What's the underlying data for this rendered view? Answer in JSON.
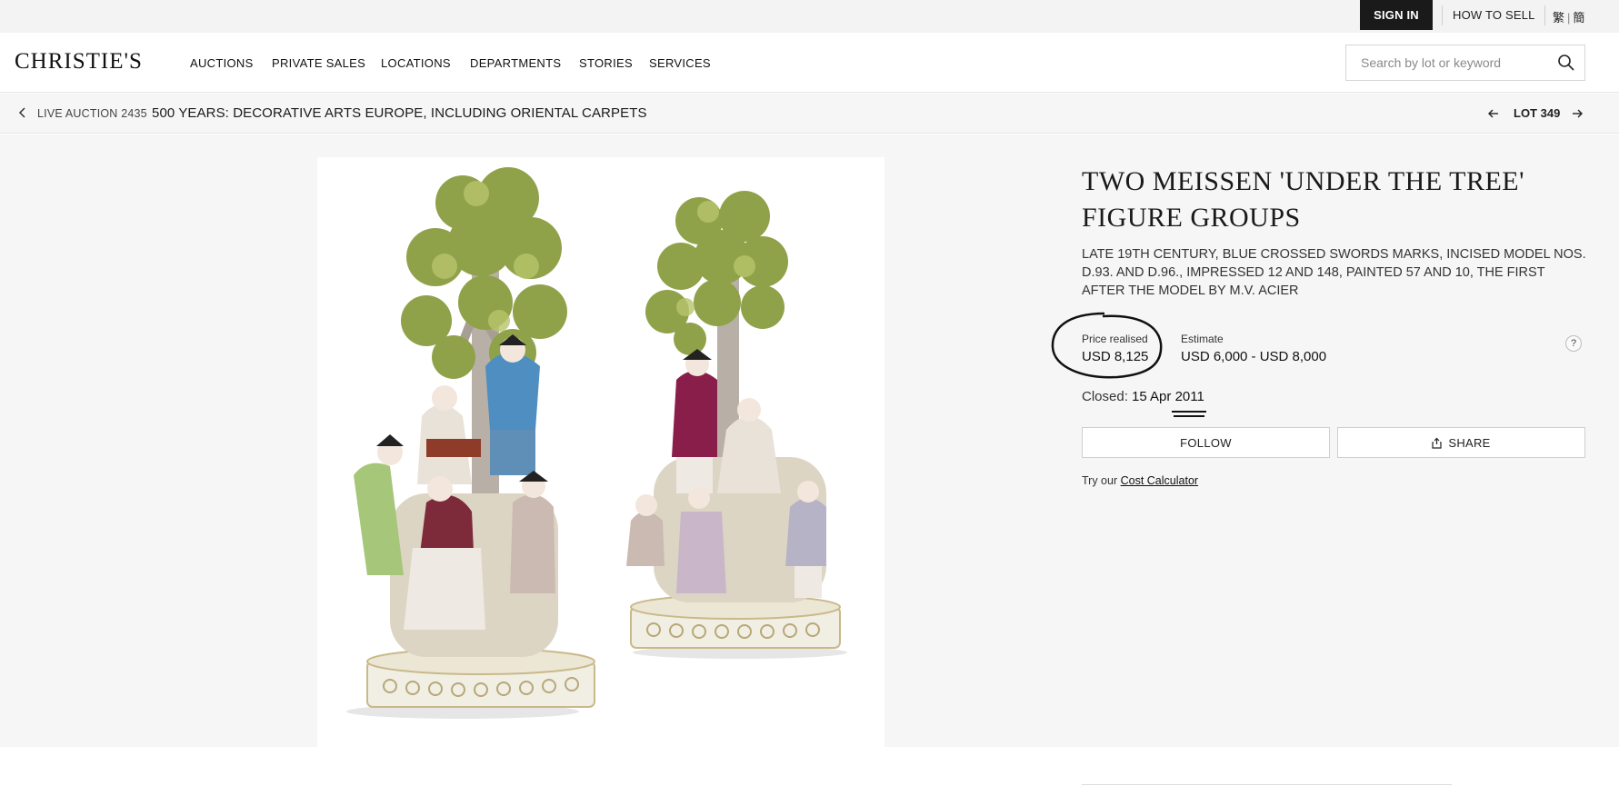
{
  "utility": {
    "sign_in": "SIGN IN",
    "how_to_sell": "HOW TO SELL",
    "lang_traditional": "繁",
    "lang_simplified": "簡"
  },
  "brand": {
    "logo": "CHRISTIE'S"
  },
  "nav": {
    "items": [
      "AUCTIONS",
      "PRIVATE SALES",
      "LOCATIONS",
      "DEPARTMENTS",
      "STORIES",
      "SERVICES"
    ]
  },
  "search": {
    "placeholder": "Search by lot or keyword",
    "value": ""
  },
  "breadcrumb": {
    "live_auction": "LIVE AUCTION 2435",
    "sale_title": "500 YEARS: DECORATIVE ARTS EUROPE, INCLUDING ORIENTAL CARPETS",
    "lot": "LOT 349"
  },
  "lot": {
    "title": "TWO MEISSEN 'UNDER THE TREE' FIGURE GROUPS",
    "subtitle": "LATE 19TH CENTURY, BLUE CROSSED SWORDS MARKS, INCISED MODEL NOS. D.93. AND D.96., IMPRESSED 12 AND 148, PAINTED 57 AND 10, THE FIRST AFTER THE MODEL BY M.V. ACIER",
    "price_label": "Price realised",
    "price_value": "USD 8,125",
    "estimate_label": "Estimate",
    "estimate_value": "USD 6,000 - USD 8,000",
    "help": "?",
    "closed_label": "Closed: ",
    "closed_date": "15 Apr 2011",
    "follow_label": "FOLLOW",
    "share_label": "SHARE",
    "calc_prefix": "Try our ",
    "calc_link": "Cost Calculator"
  },
  "icons": {
    "search": "search-icon",
    "back": "chevron-left-icon",
    "prev": "arrow-left-icon",
    "next": "arrow-right-icon",
    "share": "share-icon",
    "help": "help-icon"
  },
  "colors": {
    "sign_in_bg": "#1a1a1a",
    "page_bg": "#f6f6f6",
    "annotation": "#111111"
  }
}
